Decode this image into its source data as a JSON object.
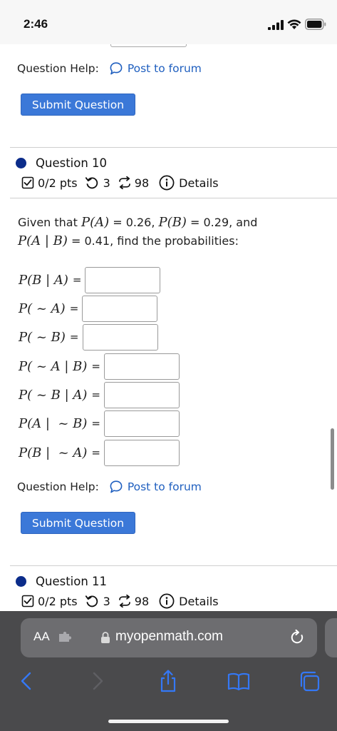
{
  "status_bar": {
    "time": "2:46"
  },
  "question_9_footer": {
    "help_label": "Question Help:",
    "help_link": "Post to forum",
    "submit_label": "Submit Question"
  },
  "question_10": {
    "title": "Question 10",
    "points": "0/2 pts",
    "attempts": "3",
    "retries": "98",
    "details_label": "Details",
    "problem": {
      "prefix": "Given that",
      "pa_label": "P(A)",
      "pa_value": "= 0.26,",
      "pb_label": "P(B)",
      "pb_value": "= 0.29, and",
      "pab_label": "P(A | B)",
      "pab_value": "= 0.41, find the probabilities:"
    },
    "answers": [
      {
        "label": "P(B | A)",
        "eq": "=",
        "value": ""
      },
      {
        "label": "P( ~ A)",
        "eq": "=",
        "value": ""
      },
      {
        "label": "P( ~ B)",
        "eq": "=",
        "value": ""
      },
      {
        "label": "P( ~ A | B)",
        "eq": "=",
        "value": ""
      },
      {
        "label": "P( ~ B | A)",
        "eq": "=",
        "value": ""
      },
      {
        "label": "P(A |  ~ B)",
        "eq": "=",
        "value": ""
      },
      {
        "label": "P(B |  ~ A)",
        "eq": "=",
        "value": ""
      }
    ],
    "help_label": "Question Help:",
    "help_link": "Post to forum",
    "submit_label": "Submit Question"
  },
  "question_11": {
    "title": "Question 11",
    "points": "0/2 pts",
    "attempts": "3",
    "retries": "98",
    "details_label": "Details"
  },
  "browser": {
    "text_size_label": "AA",
    "url": "myopenmath.com"
  },
  "colors": {
    "link": "#1f5fbf",
    "button": "#3b78d8",
    "question_dot": "#0b2c8a",
    "safari_bar": "#4a4a4c",
    "safari_accent": "#3478f6"
  }
}
